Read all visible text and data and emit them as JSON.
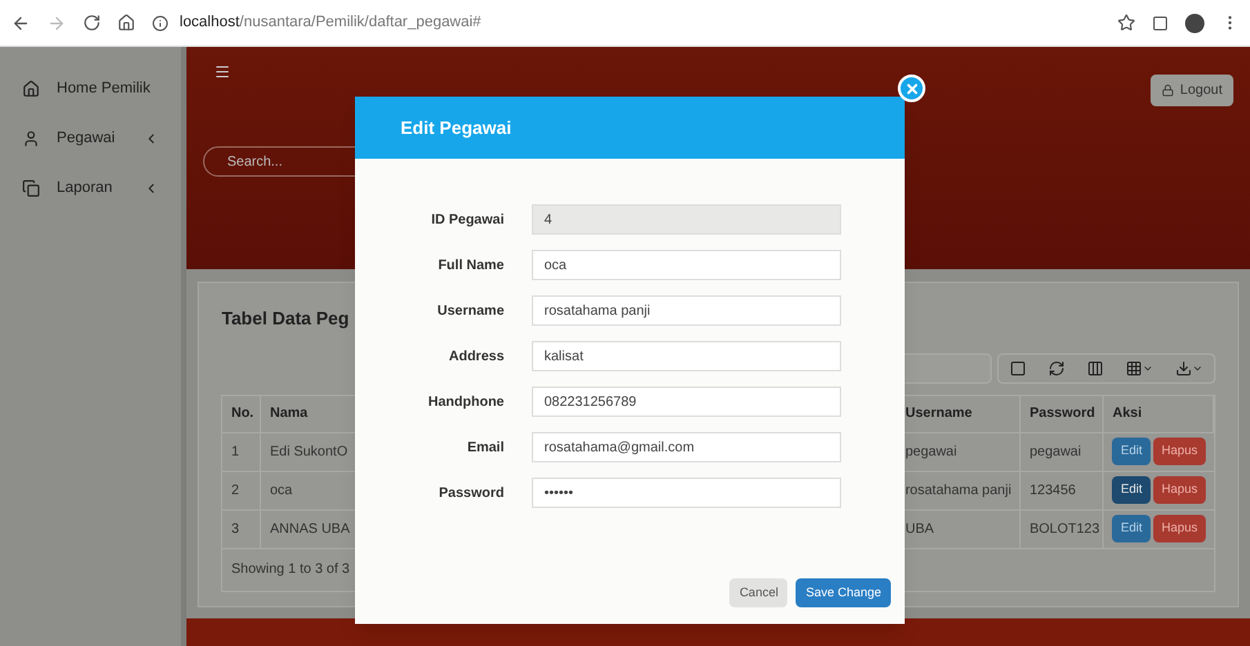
{
  "browser": {
    "url_host": "localhost",
    "url_path": "/nusantara/Pemilik/daftar_pegawai#"
  },
  "sidebar": {
    "items": [
      {
        "label": "Home Pemilik",
        "expandable": false
      },
      {
        "label": "Pegawai",
        "expandable": true
      },
      {
        "label": "Laporan",
        "expandable": true
      }
    ]
  },
  "header": {
    "logout": "Logout",
    "search": {
      "placeholder": "Search..."
    }
  },
  "card": {
    "title": "Tabel Data Peg",
    "table": {
      "columns": [
        "No.",
        "Nama",
        "Username",
        "Password",
        "Aksi"
      ],
      "rows": [
        {
          "cells": [
            "1",
            "Edi SukontO",
            "pegawai",
            "pegawai"
          ],
          "actions": [
            {
              "label": "Edit",
              "kind": "edit",
              "active": false
            },
            {
              "label": "Hapus",
              "kind": "delete"
            }
          ]
        },
        {
          "cells": [
            "2",
            "oca",
            "rosatahama panji",
            "123456"
          ],
          "actions": [
            {
              "label": "Edit",
              "kind": "edit",
              "active": true
            },
            {
              "label": "Hapus",
              "kind": "delete"
            }
          ]
        },
        {
          "cells": [
            "3",
            "ANNAS UBA",
            "UBA",
            "BOLOT123"
          ],
          "actions": [
            {
              "label": "Edit",
              "kind": "edit",
              "active": false
            },
            {
              "label": "Hapus",
              "kind": "delete"
            }
          ]
        }
      ]
    },
    "footer": "Showing 1 to 3 of 3"
  },
  "modal": {
    "title": "Edit Pegawai",
    "fields": [
      {
        "label": "ID Pegawai",
        "value": "4",
        "kind": "readonly"
      },
      {
        "label": "Full Name",
        "value": "oca",
        "kind": "text"
      },
      {
        "label": "Username",
        "value": "rosatahama panji",
        "kind": "text"
      },
      {
        "label": "Address",
        "value": "kalisat",
        "kind": "text"
      },
      {
        "label": "Handphone",
        "value": "082231256789",
        "kind": "text"
      },
      {
        "label": "Email",
        "value": "rosatahama@gmail.com",
        "kind": "text"
      },
      {
        "label": "Password",
        "value": "••••••",
        "kind": "password"
      }
    ],
    "buttons": [
      {
        "label": "Cancel",
        "kind": "cancel"
      },
      {
        "label": "Save Change",
        "kind": "primary"
      }
    ]
  }
}
